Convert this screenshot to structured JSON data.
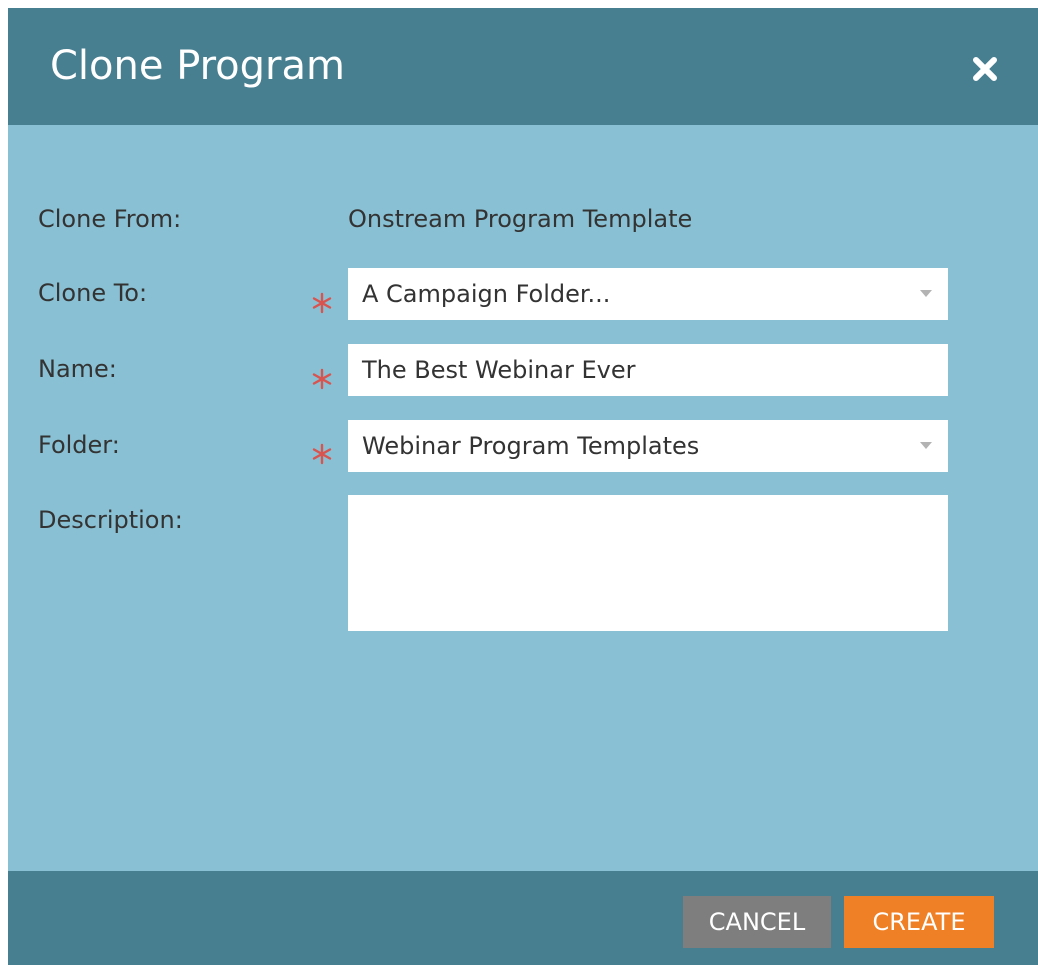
{
  "dialog": {
    "title": "Clone Program",
    "close_icon": "close-icon"
  },
  "form": {
    "clone_from": {
      "label": "Clone From:",
      "value": "Onstream Program Template"
    },
    "clone_to": {
      "label": "Clone To:",
      "value": "A Campaign Folder...",
      "required": true
    },
    "name": {
      "label": "Name:",
      "value": "The Best Webinar Ever",
      "required": true
    },
    "folder": {
      "label": "Folder:",
      "value": "Webinar Program Templates",
      "required": true
    },
    "description": {
      "label": "Description:",
      "value": ""
    }
  },
  "footer": {
    "cancel_label": "CANCEL",
    "create_label": "CREATE"
  },
  "colors": {
    "header": "#477f91",
    "body": "#89c0d3",
    "required": "#d9534f",
    "cancel": "#7e7e7e",
    "create": "#f08025"
  }
}
